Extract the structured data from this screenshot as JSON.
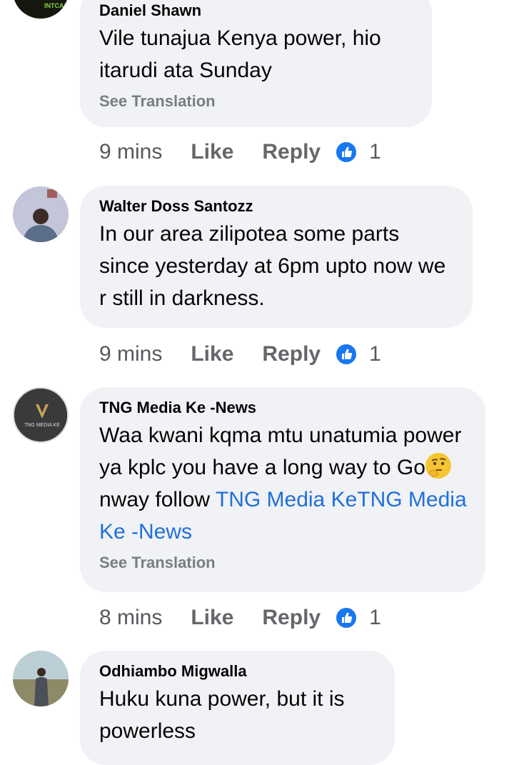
{
  "comments": [
    {
      "author": "Daniel Shawn",
      "text": "Vile tunajua Kenya power, hio itarudi ata Sunday",
      "see_translation": "See Translation",
      "time": "9 mins",
      "like_label": "Like",
      "reply_label": "Reply",
      "reactions": "1",
      "avatar_badge": "INTCAS"
    },
    {
      "author": "Walter Doss Santozz",
      "text": "In our area zilipotea some parts since yesterday at 6pm upto now we r still in darkness.",
      "time": "9 mins",
      "like_label": "Like",
      "reply_label": "Reply",
      "reactions": "1"
    },
    {
      "author": "TNG Media Ke -News",
      "text_before_emoji": "Waa kwani kqma mtu unatumia power ya kplc you have a long way to Go",
      "text_after_emoji": " nway follow ",
      "link_text": "TNG Media KeTNG Media Ke -News",
      "emoji": "thinking-face",
      "see_translation": "See Translation",
      "time": "8 mins",
      "like_label": "Like",
      "reply_label": "Reply",
      "reactions": "1",
      "avatar_badge": "TNG MEDIA KE"
    },
    {
      "author": "Odhiambo Migwalla",
      "text": "Huku kuna power, but it is powerless"
    }
  ],
  "colors": {
    "bubble": "#f0f2f5",
    "link": "#216fdb",
    "like_badge": "#1877f2",
    "meta_text": "#65676b"
  }
}
